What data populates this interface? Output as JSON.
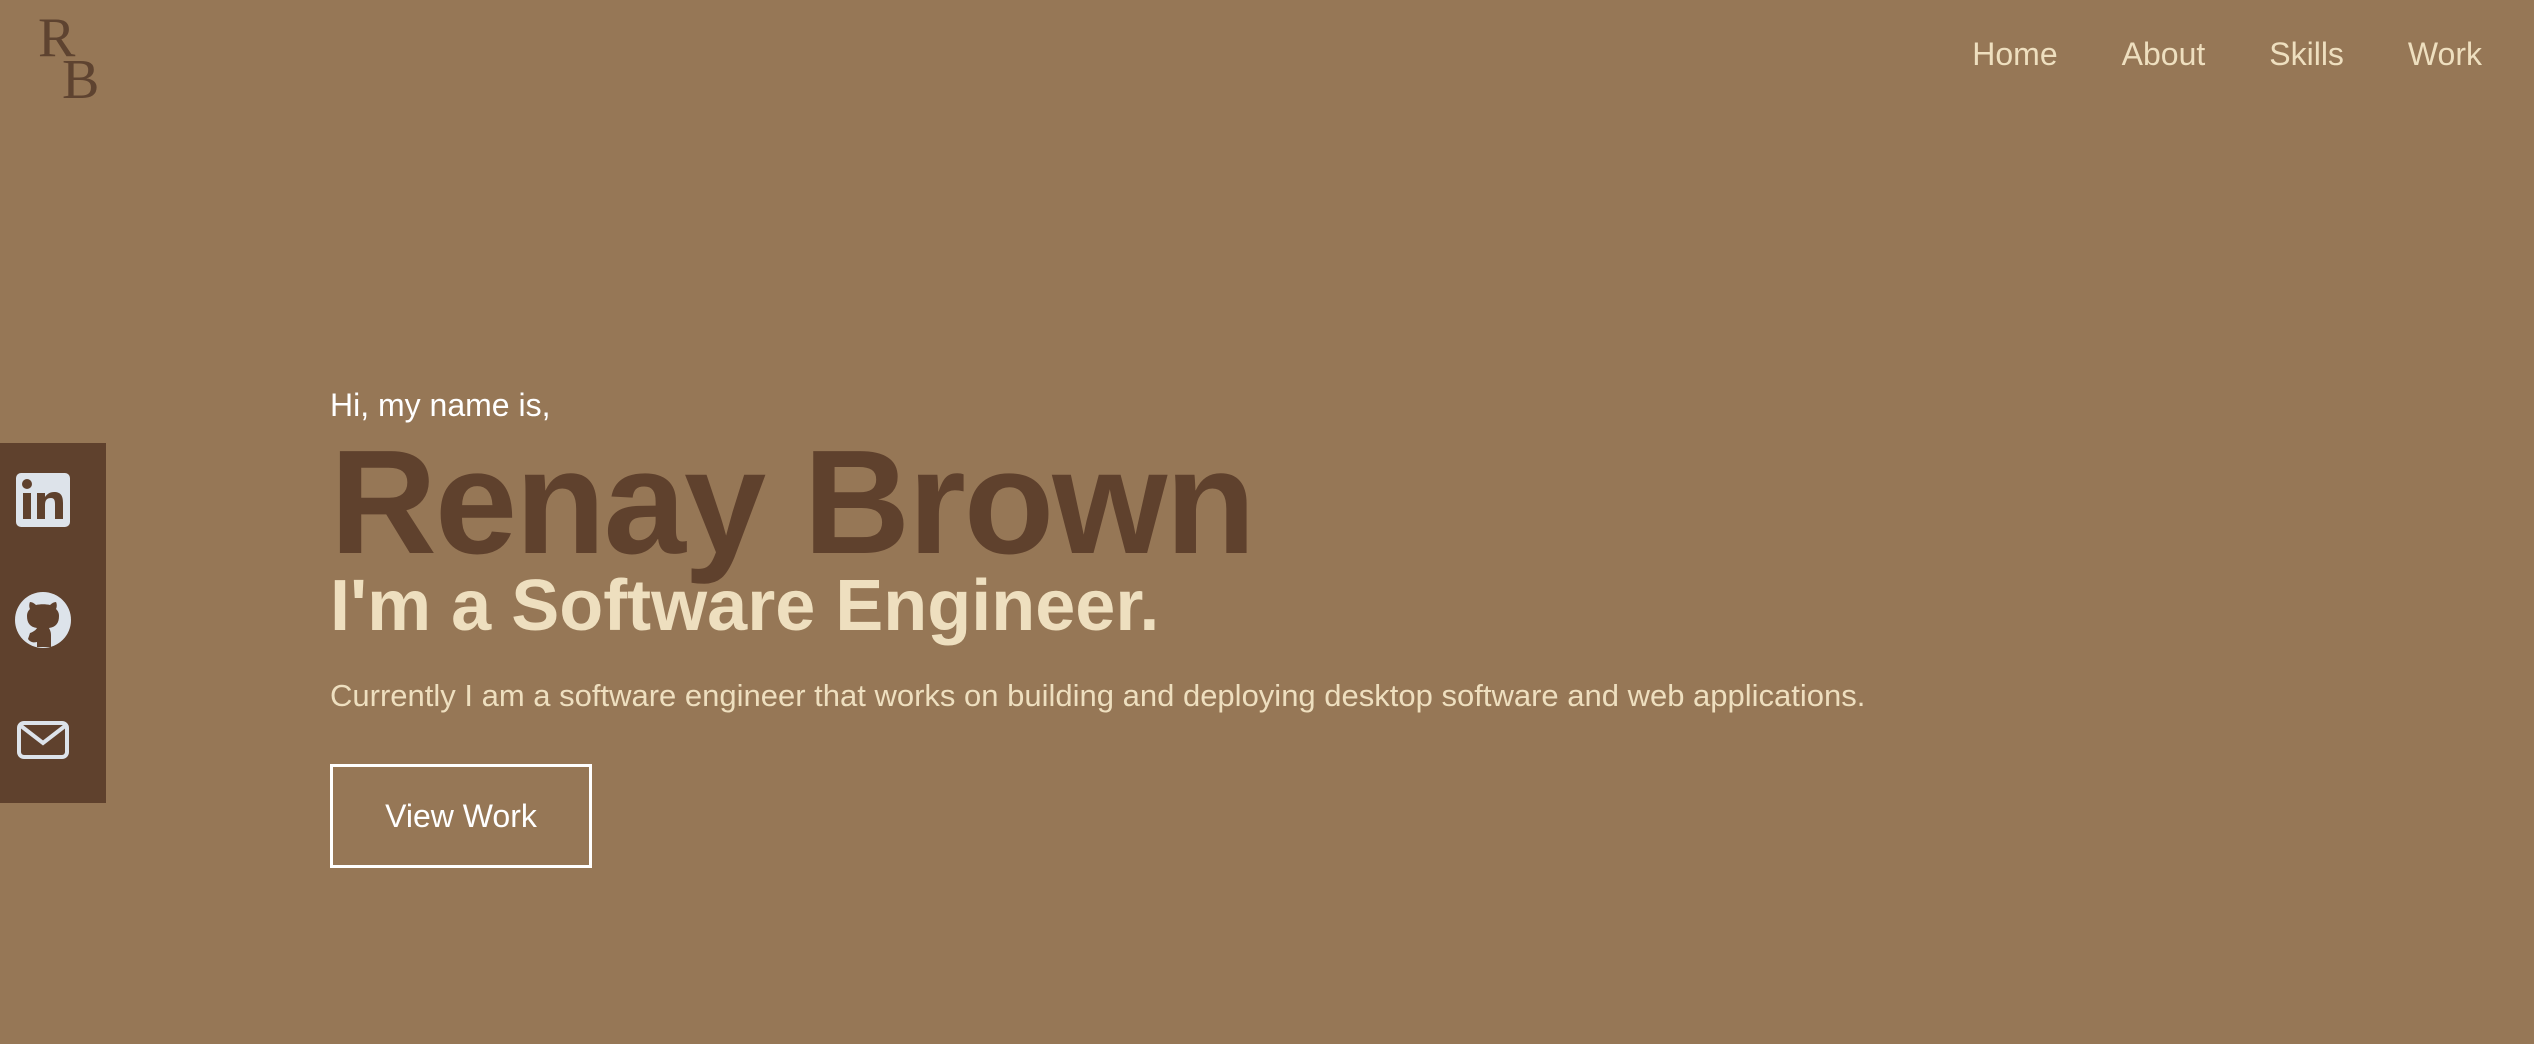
{
  "logo": {
    "letter1": "R",
    "letter2": "B"
  },
  "nav": {
    "items": [
      {
        "label": "Home"
      },
      {
        "label": "About"
      },
      {
        "label": "Skills"
      },
      {
        "label": "Work"
      }
    ]
  },
  "social": {
    "icons": [
      "linkedin-icon",
      "github-icon",
      "mail-icon"
    ]
  },
  "hero": {
    "greeting": "Hi, my name is,",
    "name": "Renay Brown",
    "role": "I'm a Software Engineer.",
    "description": "Currently I am a software engineer that works on building and deploying desktop software and web applications.",
    "button_label": "View Work"
  },
  "colors": {
    "background": "#967756",
    "dark_brown": "#5f412d",
    "cream": "#eedfbf",
    "white": "#ffffff"
  }
}
